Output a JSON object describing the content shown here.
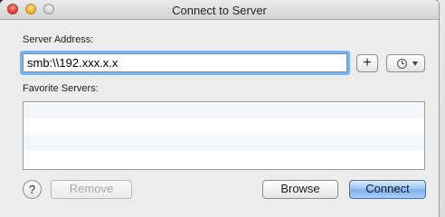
{
  "window": {
    "title": "Connect to Server"
  },
  "server_address": {
    "label": "Server Address:",
    "value": "smb:\\\\192.xxx.x.x",
    "add_label": "+"
  },
  "favorites": {
    "label": "Favorite Servers:",
    "rows": [
      "",
      "",
      "",
      ""
    ]
  },
  "buttons": {
    "help_label": "?",
    "remove_label": "Remove",
    "browse_label": "Browse",
    "connect_label": "Connect"
  },
  "icons": {
    "close": "close-icon",
    "minimize": "minimize-icon",
    "zoom": "zoom-icon",
    "recent": "clock-icon",
    "dropdown": "chevron-down-icon"
  },
  "colors": {
    "focus_ring": "#7bb3ee",
    "default_button": "#9ec6f4",
    "close": "#e0443a",
    "minimize": "#f2b33a"
  }
}
